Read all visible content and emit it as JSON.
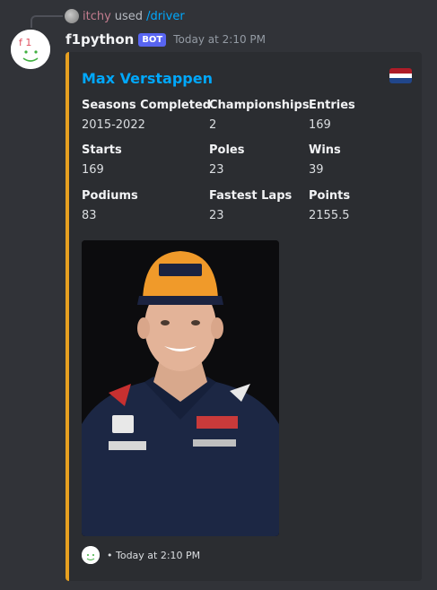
{
  "reply": {
    "user": "itchy",
    "used_text": "used",
    "command": "/driver"
  },
  "message": {
    "username": "f1python",
    "bot_tag": "BOT",
    "timestamp": "Today at 2:10 PM"
  },
  "embed": {
    "title": "Max Verstappen",
    "accent_color": "#e7a020",
    "flag_colors": [
      "#ae1c28",
      "#ffffff",
      "#21468b"
    ],
    "fields": [
      {
        "name": "Seasons Completed",
        "value": "2015-2022"
      },
      {
        "name": "Championships",
        "value": "2"
      },
      {
        "name": "Entries",
        "value": "169"
      },
      {
        "name": "Starts",
        "value": "169"
      },
      {
        "name": "Poles",
        "value": "23"
      },
      {
        "name": "Wins",
        "value": "39"
      },
      {
        "name": "Podiums",
        "value": "83"
      },
      {
        "name": "Fastest Laps",
        "value": "23"
      },
      {
        "name": "Points",
        "value": "2155.5"
      }
    ],
    "footer": "• Today at 2:10 PM"
  }
}
